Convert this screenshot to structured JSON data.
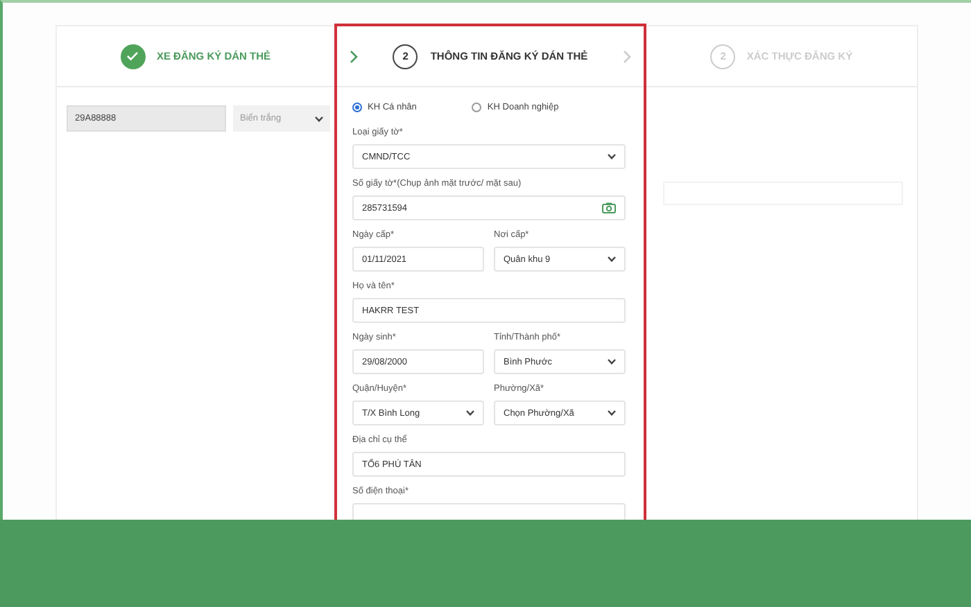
{
  "steps": [
    {
      "title": "XE ĐĂNG KÝ DÁN THẺ",
      "kind": "done"
    },
    {
      "number": "2",
      "title": "THÔNG TIN ĐĂNG KÝ DÁN THẺ",
      "kind": "current"
    },
    {
      "number": "2",
      "title": "XÁC THỰC ĐĂNG KÝ",
      "kind": "upcoming"
    }
  ],
  "vehicle": {
    "plate": "29A88888",
    "plate_type": "Biển trắng"
  },
  "customer_types": [
    {
      "label": "KH Cá nhân",
      "selected": true
    },
    {
      "label": "KH Doanh nghiệp",
      "selected": false
    }
  ],
  "form_rows": [
    [
      {
        "label": "Loại giấy tờ*",
        "value": "CMND/TCC",
        "kind": "select"
      }
    ],
    [
      {
        "label": "Số giấy tờ*(Chụp ảnh mặt trước/ mặt sau)",
        "value": "285731594",
        "kind": "camera"
      }
    ],
    [
      {
        "label": "Ngày cấp*",
        "value": "01/11/2021",
        "kind": "text"
      },
      {
        "label": "Nơi cấp*",
        "value": "Quân khu 9",
        "kind": "select"
      }
    ],
    [
      {
        "label": "Họ và tên*",
        "value": "HAKRR TEST",
        "kind": "text"
      }
    ],
    [
      {
        "label": "Ngày sinh*",
        "value": "29/08/2000",
        "kind": "text"
      },
      {
        "label": "Tỉnh/Thành phố*",
        "value": "Bình Phước",
        "kind": "select"
      }
    ],
    [
      {
        "label": "Quận/Huyện*",
        "value": "T/X Bình Long",
        "kind": "select"
      },
      {
        "label": "Phường/Xã*",
        "value": "Chọn Phường/Xã",
        "kind": "select"
      }
    ],
    [
      {
        "label": "Địa chỉ cụ thể",
        "value": "TỔ6 PHÚ TÂN",
        "kind": "text"
      }
    ],
    [
      {
        "label": "Số điện thoại*",
        "kind": "text"
      }
    ]
  ]
}
